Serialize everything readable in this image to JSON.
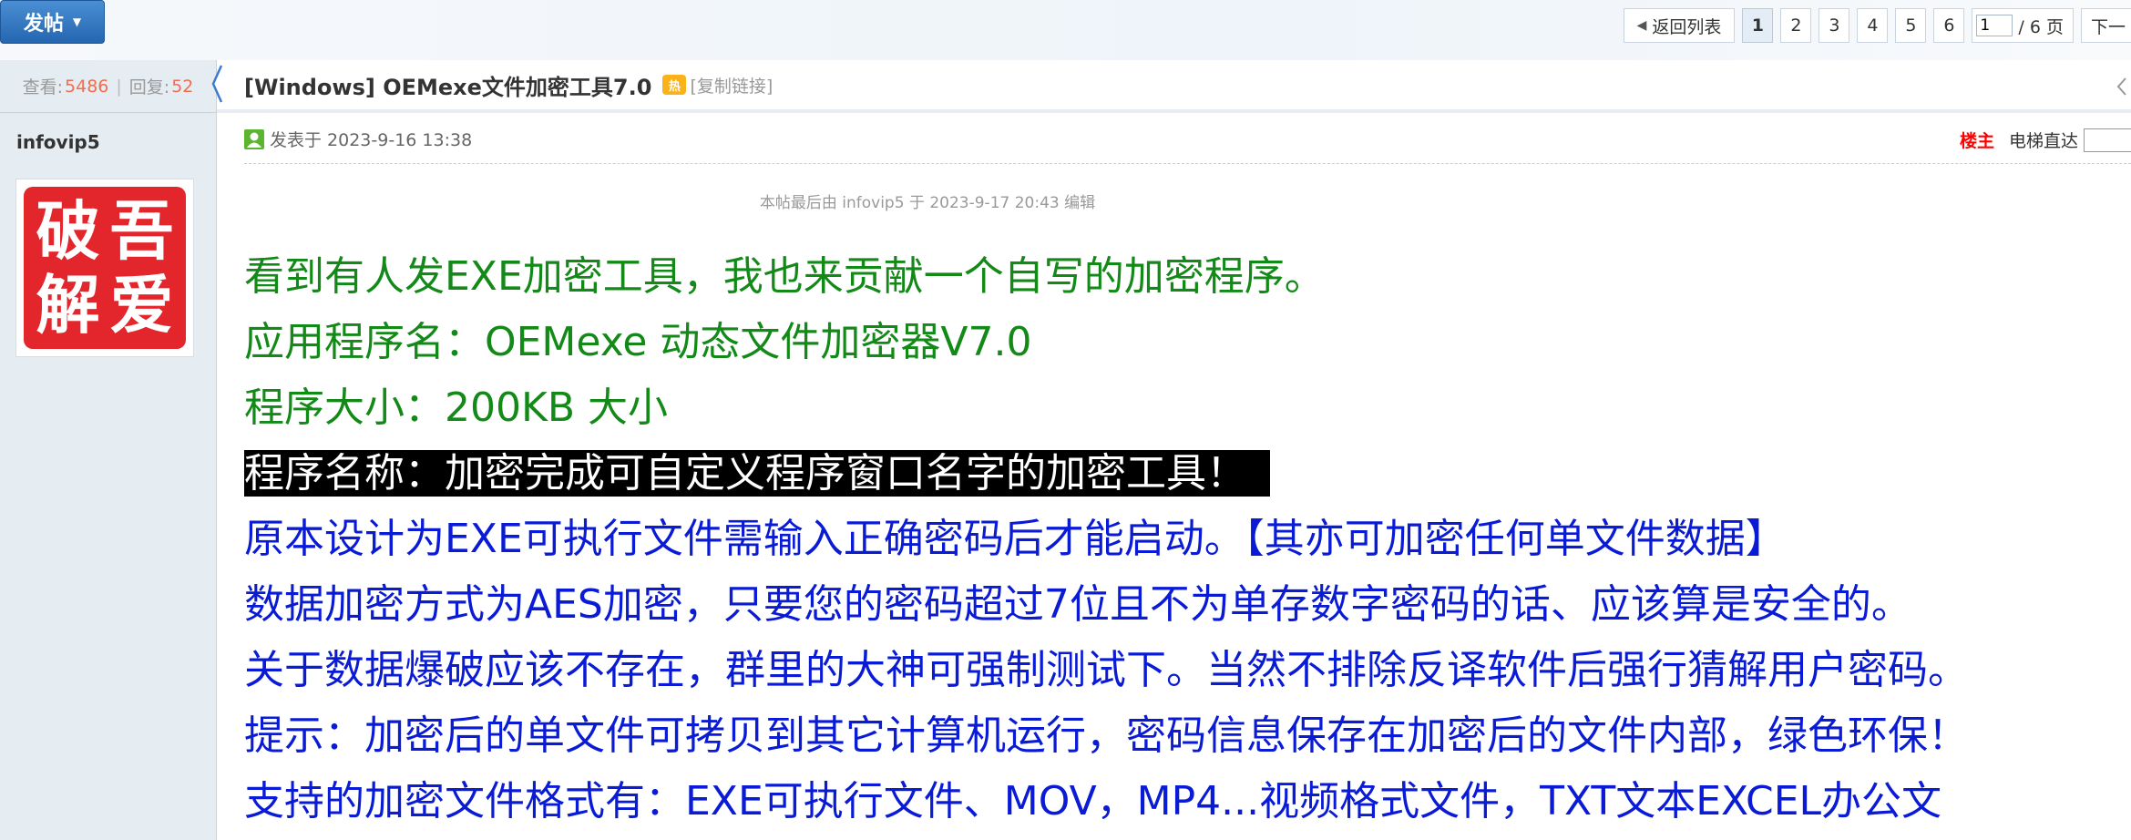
{
  "toolbar": {
    "post_button": "发帖"
  },
  "pager": {
    "back_label": "返回列表",
    "pages": [
      "1",
      "2",
      "3",
      "4",
      "5",
      "6"
    ],
    "current_page": "1",
    "page_input": "1",
    "total_label": "/ 6 页",
    "next_label": "下一"
  },
  "sidebar": {
    "views_label": "查看:",
    "views": "5486",
    "replies_label": "回复:",
    "replies": "52",
    "username": "infovip5",
    "avatar_chars": [
      "破",
      "吾",
      "解",
      "爱"
    ]
  },
  "thread": {
    "title": "[Windows] OEMexe文件加密工具7.0",
    "copy_link": "[复制链接]",
    "posted": "发表于 2023-9-16 13:38",
    "op_label": "楼主",
    "elevator_label": "电梯直达",
    "edited_note": "本帖最后由 infovip5 于 2023-9-17 20:43 编辑"
  },
  "content": {
    "lines": [
      "看到有人发EXE加密工具，我也来贡献一个自写的加密程序。",
      "应用程序名：OEMexe 动态文件加密器V7.0",
      "程序大小：200KB 大小",
      "程序名称：加密完成可自定义程序窗口名字的加密工具！",
      "原本设计为EXE可执行文件需输入正确密码后才能启动。【其亦可加密任何单文件数据】",
      "数据加密方式为AES加密，只要您的密码超过7位且不为单存数字密码的话、应该算是安全的。",
      "关于数据爆破应该不存在，群里的大神可强制测试下。当然不排除反译软件后强行猜解用户密码。",
      "提示：加密后的单文件可拷贝到其它计算机运行，密码信息保存在加密后的文件内部，绿色环保！",
      "支持的加密文件格式有：EXE可执行文件、MOV，MP4...视频格式文件，TXT文本EXCEL办公文"
    ]
  },
  "colors": {
    "green_text": "#138a18",
    "blue_text": "#0a1bd6",
    "accent_blue": "#2466b0",
    "number_orange": "#f26c4f",
    "op_red": "#ff0000"
  }
}
